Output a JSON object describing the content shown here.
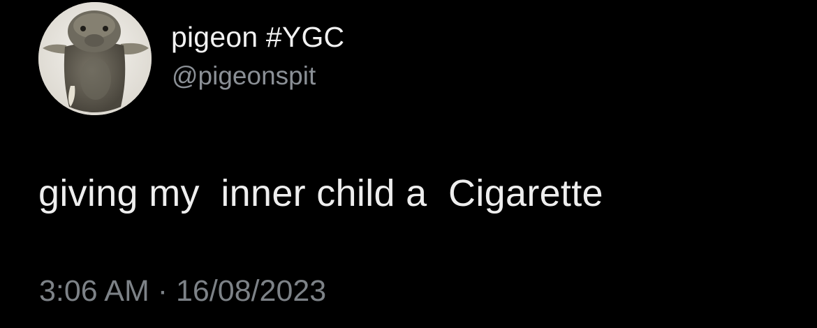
{
  "tweet": {
    "author": {
      "display_name": "pigeon #YGC",
      "handle": "@pigeonspit",
      "avatar_icon": "sea-creature-photo-avatar"
    },
    "text": "giving my  inner child a  Cigarette",
    "timestamp": {
      "time": "3:06 AM",
      "separator": "·",
      "date": "16/08/2023"
    }
  },
  "colors": {
    "background": "#000000",
    "name_text": "#f2f2f2",
    "handle_text": "#8b9096",
    "body_text": "#eeeeee",
    "meta_text": "#7d8287"
  }
}
